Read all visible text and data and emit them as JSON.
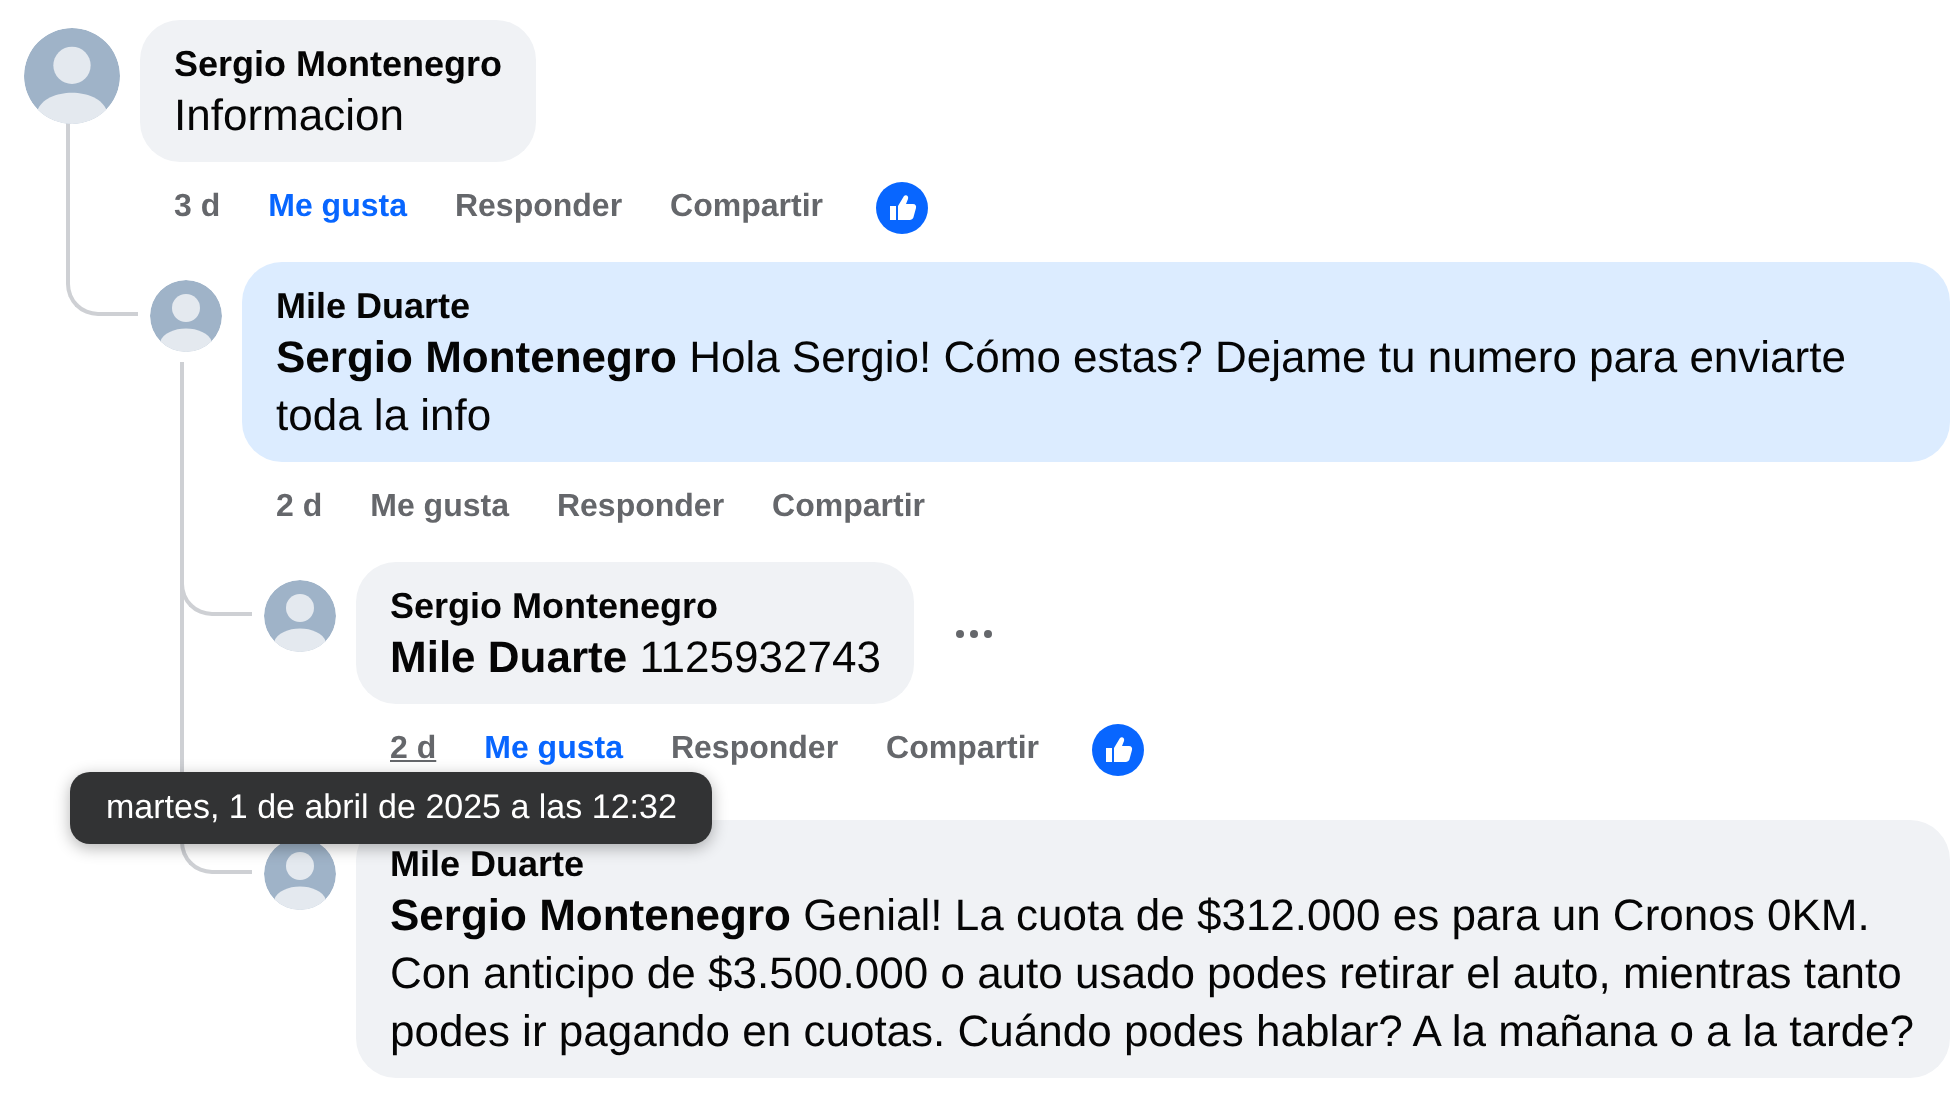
{
  "comments": [
    {
      "author": "Sergio Montenegro",
      "text": "Informacion",
      "highlighted": false,
      "show_menu": false,
      "actions": {
        "time": "3 d",
        "time_hovered": false,
        "like": "Me gusta",
        "liked": true,
        "reply": "Responder",
        "share": "Compartir",
        "has_reaction": true
      },
      "children": [
        {
          "author": "Mile Duarte",
          "text": "**Sergio Montenegro** Hola Sergio! Cómo estas? Dejame tu numero para enviarte toda la info",
          "highlighted": true,
          "show_menu": false,
          "actions": {
            "time": "2 d",
            "time_hovered": false,
            "like": "Me gusta",
            "liked": false,
            "reply": "Responder",
            "share": "Compartir",
            "has_reaction": false
          },
          "children": [
            {
              "author": "Sergio Montenegro",
              "text": "**Mile Duarte** 1125932743",
              "highlighted": false,
              "show_menu": true,
              "actions": {
                "time": "2 d",
                "time_hovered": true,
                "like": "Me gusta",
                "liked": true,
                "reply": "Responder",
                "share": "Compartir",
                "has_reaction": true
              }
            },
            {
              "author": "Mile Duarte",
              "text": "**Sergio Montenegro** Genial! La cuota de $312.000 es para un Cronos 0KM. Con anticipo de $3.500.000 o auto usado podes retirar el auto, mientras tanto podes ir pagando en cuotas. Cuándo podes hablar? A la mañana o a la tarde?",
              "highlighted": false,
              "show_menu": false
            }
          ]
        }
      ]
    }
  ],
  "tooltip": {
    "text": "martes, 1 de abril de 2025 a las 12:32"
  }
}
